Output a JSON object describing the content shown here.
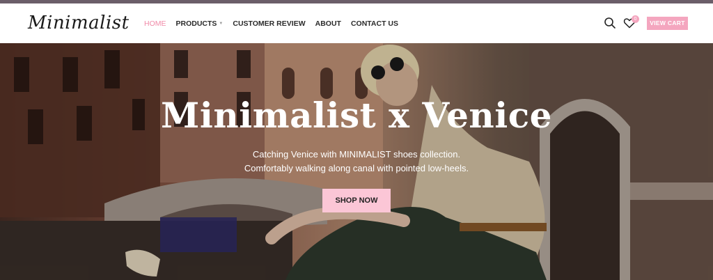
{
  "brand": {
    "logo_text": "Minimalist"
  },
  "nav": {
    "items": [
      {
        "label": "HOME",
        "active": true
      },
      {
        "label": "PRODUCTS",
        "has_dropdown": true
      },
      {
        "label": "CUSTOMER REVIEW"
      },
      {
        "label": "ABOUT"
      },
      {
        "label": "CONTACT US"
      }
    ]
  },
  "header_actions": {
    "search_icon": "search-icon",
    "wishlist_icon": "heart-icon",
    "wishlist_count": "0",
    "cart_label": "VIEW CART"
  },
  "hero": {
    "title": "Minimalist x Venice",
    "subtitle_line1": "Catching Venice with MINIMALIST shoes collection.",
    "subtitle_line2": "Comfortably walking along canal with pointed low-heels.",
    "cta_label": "SHOP NOW"
  },
  "colors": {
    "accent_pink": "#f4a6bf",
    "active_nav": "#f08aa7",
    "topbar": "#6b5e69",
    "cta_bg": "#fbc6d6"
  }
}
